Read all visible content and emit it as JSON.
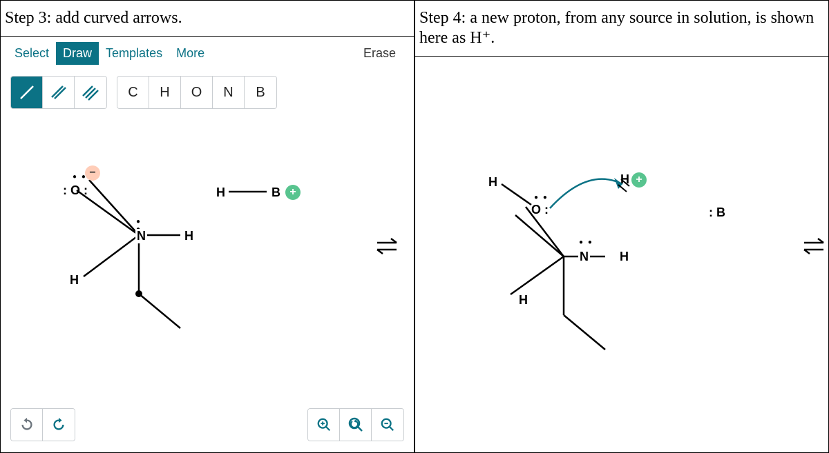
{
  "panels": {
    "left": {
      "title": "Step 3: add curved arrows."
    },
    "right": {
      "title": "Step 4: a new proton, from any source in solution, is shown here as H⁺."
    }
  },
  "toolbar": {
    "tabs": {
      "select": "Select",
      "draw": "Draw",
      "templates": "Templates",
      "more": "More"
    },
    "erase": "Erase",
    "atoms": {
      "C": "C",
      "H": "H",
      "O": "O",
      "N": "N",
      "B": "B"
    }
  },
  "labels": {
    "H": "H",
    "O": "O",
    "N": "N",
    "B": "B",
    "Hplus": "H",
    "colonB": ": B",
    "colonO": "O",
    "minus": "−",
    "plus": "+"
  }
}
